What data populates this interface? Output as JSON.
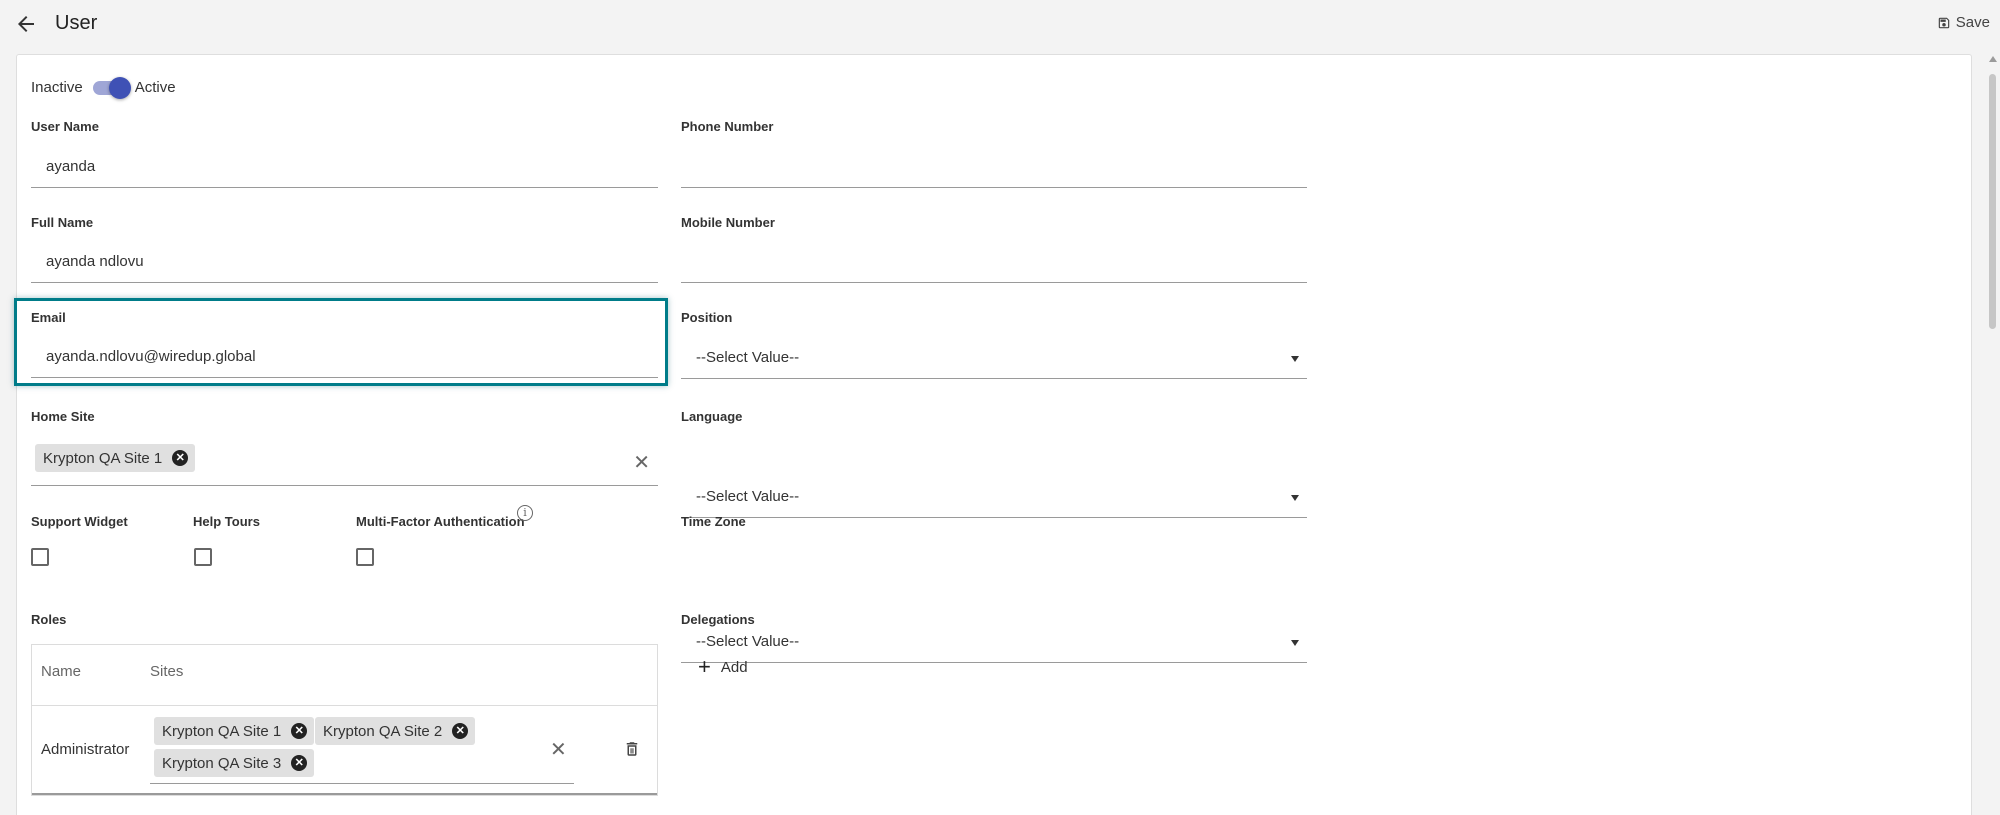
{
  "header": {
    "title": "User",
    "save_label": "Save"
  },
  "status": {
    "inactive_label": "Inactive",
    "active_label": "Active",
    "active": true
  },
  "fields": {
    "user_name": {
      "label": "User Name",
      "value": "ayanda"
    },
    "full_name": {
      "label": "Full Name",
      "value": "ayanda ndlovu"
    },
    "email": {
      "label": "Email",
      "value": "ayanda.ndlovu@wiredup.global"
    },
    "phone_number": {
      "label": "Phone Number",
      "value": ""
    },
    "mobile_number": {
      "label": "Mobile Number",
      "value": ""
    },
    "position": {
      "label": "Position",
      "value": "--Select Value--"
    },
    "language": {
      "label": "Language",
      "value": "--Select Value--"
    },
    "time_zone": {
      "label": "Time Zone",
      "value": "--Select Value--"
    }
  },
  "home_site": {
    "label": "Home Site",
    "chips": [
      "Krypton QA Site 1"
    ]
  },
  "checkboxes": [
    {
      "label": "Support Widget",
      "checked": false
    },
    {
      "label": "Help Tours",
      "checked": false
    },
    {
      "label": "Multi-Factor Authentication",
      "checked": false
    }
  ],
  "roles": {
    "label": "Roles",
    "columns": [
      "Name",
      "Sites"
    ],
    "rows": [
      {
        "name": "Administrator",
        "sites": [
          "Krypton QA Site 1",
          "Krypton QA Site 2",
          "Krypton QA Site 3"
        ]
      }
    ]
  },
  "delegations": {
    "label": "Delegations",
    "add_label": "Add"
  },
  "icons": [
    "arrow-left-icon",
    "save-icon",
    "close-circle-icon",
    "close-icon",
    "info-icon",
    "trash-icon",
    "plus-icon",
    "chevron-down-icon"
  ],
  "colors": {
    "accent": "#3f51b5",
    "highlight": "#007c89"
  }
}
